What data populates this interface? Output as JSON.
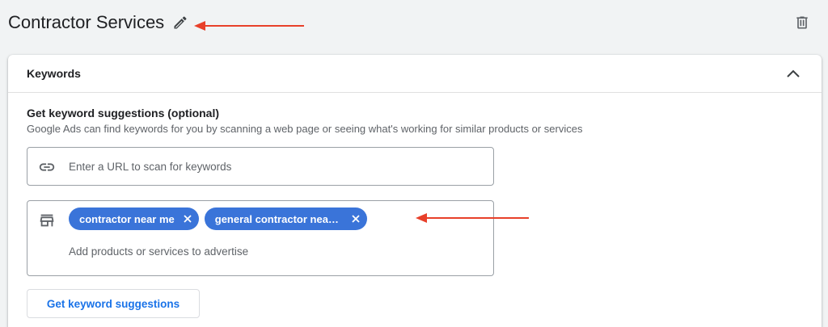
{
  "header": {
    "ad_group_name": "Contractor Services",
    "edit_icon": "pencil-icon",
    "delete_icon": "trash-icon"
  },
  "keywords_card": {
    "title": "Keywords",
    "collapse_icon": "chevron-up-icon",
    "suggestions": {
      "title": "Get keyword suggestions (optional)",
      "description": "Google Ads can find keywords for you by scanning a web page or seeing what's working for similar products or services",
      "url_field": {
        "icon": "link-icon",
        "placeholder": "Enter a URL to scan for keywords",
        "value": ""
      },
      "services_field": {
        "icon": "storefront-icon",
        "chips": [
          {
            "label": "contractor near me"
          },
          {
            "label": "general contractor near me"
          }
        ],
        "placeholder": "Add products or services to advertise",
        "value": ""
      },
      "button_label": "Get keyword suggestions"
    }
  },
  "colors": {
    "page_background": "#f1f3f4",
    "chip_background": "#3a74d9",
    "primary_blue": "#1a73e8",
    "annotation_arrow": "#e8402a",
    "text_primary": "#202124",
    "text_secondary": "#5f6368"
  }
}
